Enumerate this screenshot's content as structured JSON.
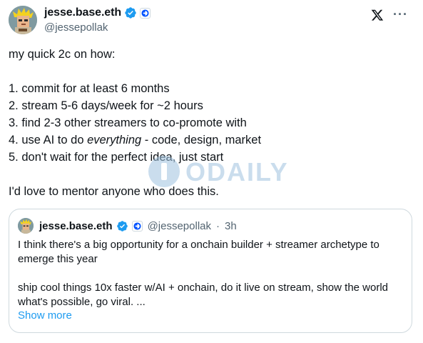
{
  "author": {
    "display_name": "jesse.base.eth",
    "handle": "@jessepollak"
  },
  "icons": {
    "verified": "verified-badge-icon",
    "affiliate": "base-affiliate-icon",
    "x_logo": "x-logo-icon",
    "more": "more-options-icon",
    "avatar": "pixel-art-avatar"
  },
  "colors": {
    "text": "#0f1419",
    "secondary": "#536471",
    "link": "#1d9bf0",
    "verified": "#1d9bf0",
    "border": "#cfd9de"
  },
  "tweet": {
    "intro": "my quick 2c on how:",
    "items": [
      "1. commit for at least 6 months",
      "2. stream 5-6 days/week for ~2 hours",
      "3. find 2-3 other streamers to co-promote with",
      "5. don't wait for the perfect idea, just start"
    ],
    "item4_prefix": "4. use AI to do ",
    "item4_emphasis": "everything",
    "item4_suffix": " - code, design, market",
    "closing": "I'd love to mentor anyone who does this."
  },
  "watermark": {
    "text": "ODAILY"
  },
  "quote": {
    "display_name": "jesse.base.eth",
    "handle": "@jessepollak",
    "separator": "·",
    "time": "3h",
    "paragraph1": "I think there's a big opportunity for a onchain builder + streamer archetype to emerge this year",
    "paragraph2": "ship cool things 10x faster w/AI + onchain, do it live on stream, show the world what's possible, go viral. ...",
    "show_more": "Show more"
  }
}
